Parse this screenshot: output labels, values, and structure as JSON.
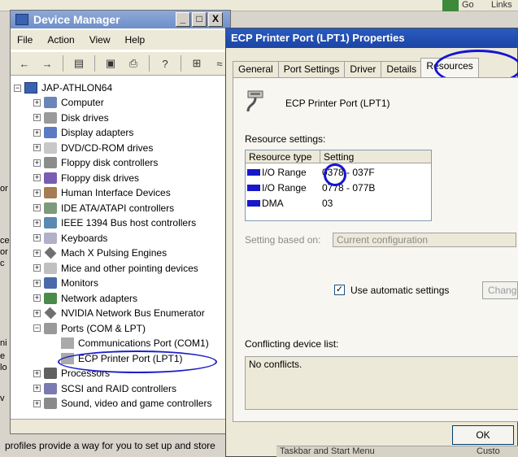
{
  "background": {
    "go_label": "Go",
    "links_label": "Links",
    "left_fragments": [
      "or",
      "ce",
      "or",
      "c",
      "ni",
      "e",
      "lo",
      "v"
    ]
  },
  "device_manager": {
    "title": "Device Manager",
    "window_buttons": {
      "minimize": "_",
      "maximize": "□",
      "close": "X"
    },
    "menu": [
      "File",
      "Action",
      "View",
      "Help"
    ],
    "tree": {
      "root": "JAP-ATHLON64",
      "categories": [
        {
          "label": "Computer",
          "icon": "computer-icon"
        },
        {
          "label": "Disk drives",
          "icon": "disk-drive-icon"
        },
        {
          "label": "Display adapters",
          "icon": "display-adapter-icon"
        },
        {
          "label": "DVD/CD-ROM drives",
          "icon": "cdrom-icon"
        },
        {
          "label": "Floppy disk controllers",
          "icon": "floppy-controller-icon"
        },
        {
          "label": "Floppy disk drives",
          "icon": "floppy-drive-icon"
        },
        {
          "label": "Human Interface Devices",
          "icon": "hid-icon"
        },
        {
          "label": "IDE ATA/ATAPI controllers",
          "icon": "ide-controller-icon"
        },
        {
          "label": "IEEE 1394 Bus host controllers",
          "icon": "ieee1394-icon"
        },
        {
          "label": "Keyboards",
          "icon": "keyboard-icon"
        },
        {
          "label": "Mach  X Pulsing Engines",
          "icon": "diamond-device-icon"
        },
        {
          "label": "Mice and other pointing devices",
          "icon": "mouse-icon"
        },
        {
          "label": "Monitors",
          "icon": "monitor-icon"
        },
        {
          "label": "Network adapters",
          "icon": "network-adapter-icon"
        },
        {
          "label": "NVIDIA Network Bus Enumerator",
          "icon": "diamond-device-icon"
        },
        {
          "label": "Ports (COM & LPT)",
          "icon": "port-icon"
        }
      ],
      "ports_children": [
        "Communications Port (COM1)",
        "ECP Printer Port (LPT1)"
      ],
      "after_categories": [
        {
          "label": "Processors",
          "icon": "processor-icon"
        },
        {
          "label": "SCSI and RAID controllers",
          "icon": "scsi-icon"
        },
        {
          "label": "Sound, video and game controllers",
          "icon": "sound-icon"
        }
      ]
    },
    "status_text": "profiles provide a way for you to set up and store"
  },
  "properties": {
    "title": "ECP Printer Port (LPT1) Properties",
    "tabs": [
      "General",
      "Port Settings",
      "Driver",
      "Details",
      "Resources"
    ],
    "active_tab": "Resources",
    "device_name": "ECP Printer Port (LPT1)",
    "resource_settings_label": "Resource settings:",
    "columns": [
      "Resource type",
      "Setting"
    ],
    "resources": [
      {
        "type": "I/O Range",
        "setting": "0378 - 037F"
      },
      {
        "type": "I/O Range",
        "setting": "0778 - 077B"
      },
      {
        "type": "DMA",
        "setting": "03"
      }
    ],
    "setting_based_on_label": "Setting based on:",
    "setting_based_on_value": "Current configuration",
    "use_auto_label": "Use automatic settings",
    "use_auto_checked": "✓",
    "change_button": "Change Setting...",
    "conflict_label": "Conflicting device list:",
    "conflict_text": "No conflicts.",
    "ok_button": "OK"
  },
  "taskbar": {
    "left_text": "Taskbar and Start Menu",
    "right_text": "Custo"
  },
  "colors": {
    "annotation_circle": "#1414d2",
    "title_active": "#1c44a4",
    "title_inactive": "#7b97cf"
  }
}
